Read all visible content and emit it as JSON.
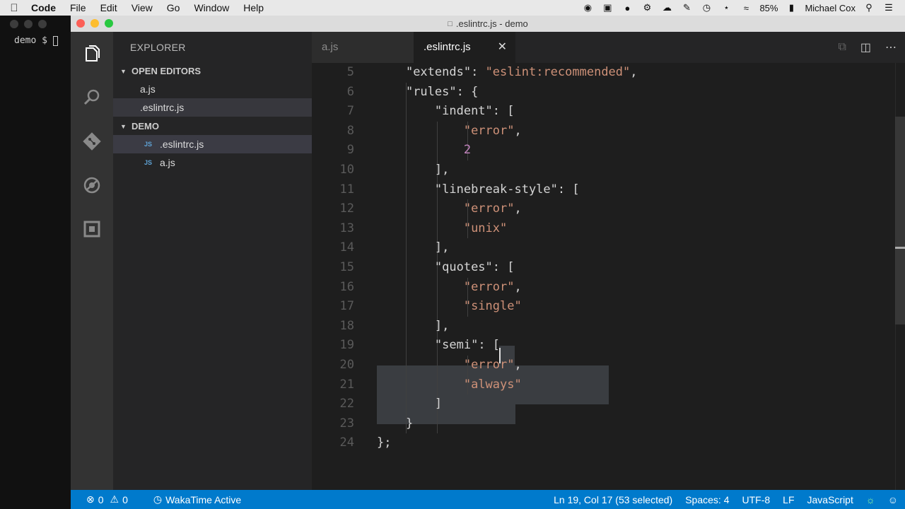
{
  "menubar": {
    "items": [
      "Code",
      "File",
      "Edit",
      "View",
      "Go",
      "Window",
      "Help"
    ],
    "battery": "85%",
    "user": "Michael Cox"
  },
  "terminal": {
    "prompt": "demo $ "
  },
  "window": {
    "title": ".eslintrc.js - demo"
  },
  "sidebar": {
    "title": "EXPLORER",
    "open_editors_label": "OPEN EDITORS",
    "open_editors": [
      "a.js",
      ".eslintrc.js"
    ],
    "folder_label": "DEMO",
    "files": [
      {
        "badge": "JS",
        "name": ".eslintrc.js"
      },
      {
        "badge": "JS",
        "name": "a.js"
      }
    ]
  },
  "tabs": [
    {
      "label": "a.js",
      "active": false
    },
    {
      "label": ".eslintrc.js",
      "active": true
    }
  ],
  "editor": {
    "lines": [
      {
        "n": "5",
        "text": "    \"extends\": \"eslint:recommended\","
      },
      {
        "n": "6",
        "text": "    \"rules\": {"
      },
      {
        "n": "7",
        "text": "        \"indent\": ["
      },
      {
        "n": "8",
        "text": "            \"error\","
      },
      {
        "n": "9",
        "text": "            2"
      },
      {
        "n": "10",
        "text": "        ],"
      },
      {
        "n": "11",
        "text": "        \"linebreak-style\": ["
      },
      {
        "n": "12",
        "text": "            \"error\","
      },
      {
        "n": "13",
        "text": "            \"unix\""
      },
      {
        "n": "14",
        "text": "        ],"
      },
      {
        "n": "15",
        "text": "        \"quotes\": ["
      },
      {
        "n": "16",
        "text": "            \"error\","
      },
      {
        "n": "17",
        "text": "            \"single\""
      },
      {
        "n": "18",
        "text": "        ],"
      },
      {
        "n": "19",
        "text": "        \"semi\": ["
      },
      {
        "n": "20",
        "text": "            \"error\","
      },
      {
        "n": "21",
        "text": "            \"always\""
      },
      {
        "n": "22",
        "text": "        ]"
      },
      {
        "n": "23",
        "text": "    }"
      },
      {
        "n": "24",
        "text": "};"
      }
    ]
  },
  "statusbar": {
    "errors": "0",
    "warnings": "0",
    "wakatime": "WakaTime Active",
    "position": "Ln 19, Col 17 (53 selected)",
    "spaces": "Spaces: 4",
    "encoding": "UTF-8",
    "eol": "LF",
    "language": "JavaScript"
  },
  "colors": {
    "accent": "#007acc",
    "string": "#ce9178",
    "number": "#c586c0"
  }
}
